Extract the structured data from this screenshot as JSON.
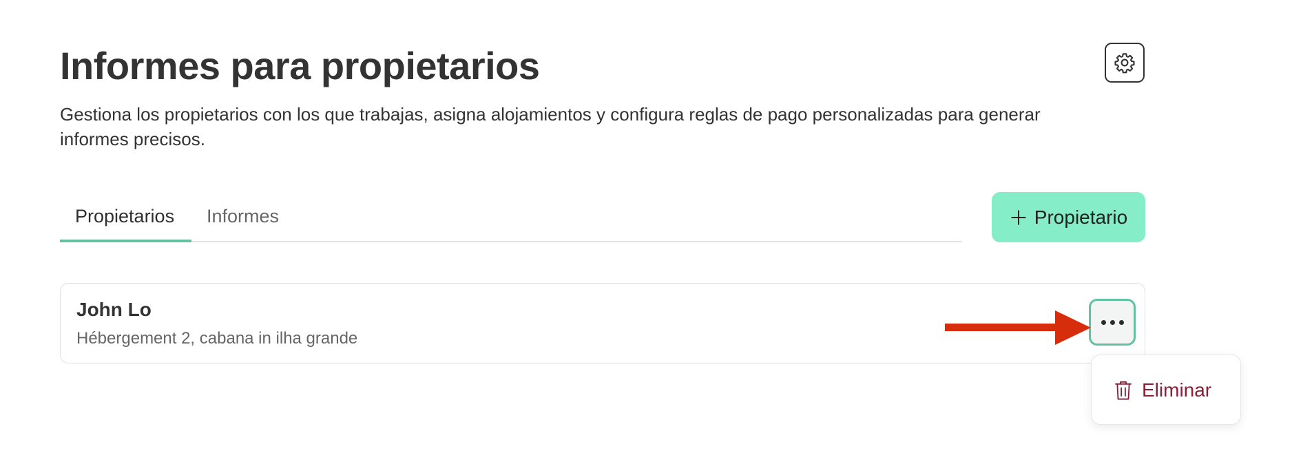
{
  "header": {
    "title": "Informes para propietarios",
    "subtitle": "Gestiona los propietarios con los que trabajas, asigna alojamientos y configura reglas de pago personalizadas para generar informes precisos.",
    "settings_icon": "gear-icon"
  },
  "tabs": [
    {
      "label": "Propietarios",
      "active": true
    },
    {
      "label": "Informes",
      "active": false
    }
  ],
  "add_button": {
    "icon": "plus-icon",
    "label": "Propietario"
  },
  "owners": [
    {
      "name": "John Lo",
      "properties": "Hébergement 2, cabana in ilha grande"
    }
  ],
  "row_menu": {
    "more_icon": "more-horizontal-icon",
    "items": [
      {
        "label": "Eliminar",
        "icon": "trash-icon"
      }
    ]
  },
  "colors": {
    "accent": "#62c1a0",
    "primary_button": "#85edc7",
    "danger": "#8b1f3a",
    "annotation_arrow": "#d62d0d"
  }
}
